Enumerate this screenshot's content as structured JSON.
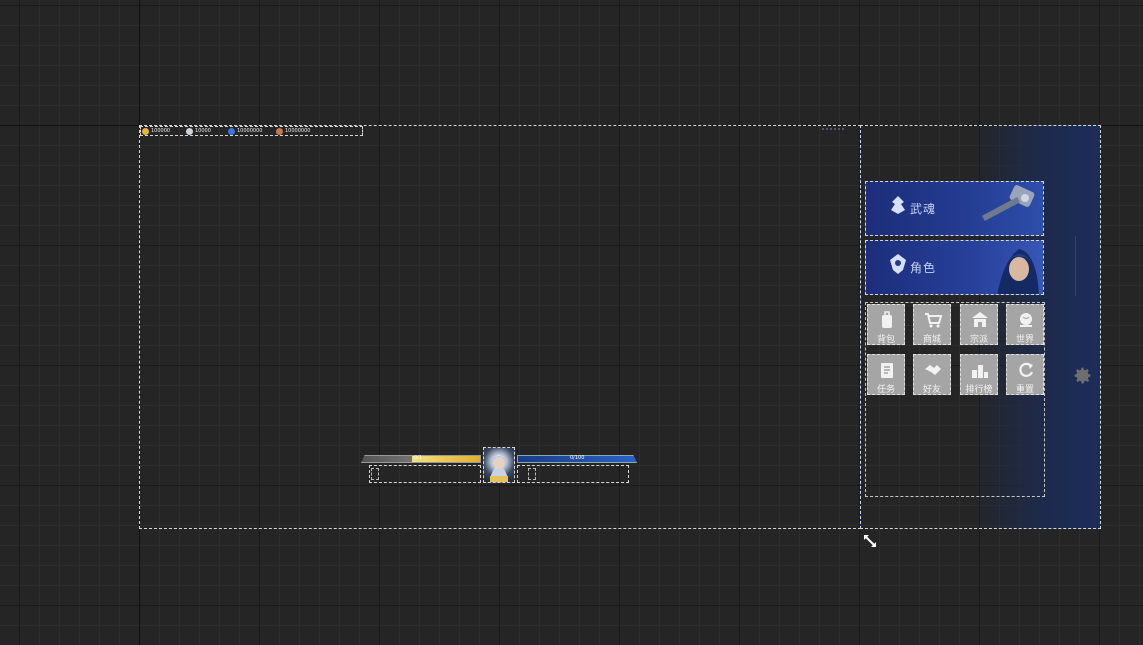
{
  "resources": [
    {
      "icon": "gold-coin-icon",
      "value": "100000",
      "color": "#e8b43a"
    },
    {
      "icon": "silver-coin-icon",
      "value": "10000",
      "color": "#cfd4d8"
    },
    {
      "icon": "blue-gem-icon",
      "value": "10000000",
      "color": "#3a74e0"
    },
    {
      "icon": "copper-coin-icon",
      "value": "10000000",
      "color": "#c57a4a"
    }
  ],
  "hud": {
    "hp_text": "0/1",
    "mp_text": "0/100",
    "hp_color": "#f0d060",
    "mp_color": "#2a62c6"
  },
  "side_menu": {
    "main_buttons": [
      {
        "label": "武魂",
        "icon": "soul-emblem-icon"
      },
      {
        "label": "角色",
        "icon": "role-emblem-icon"
      }
    ],
    "small_buttons": [
      {
        "label": "背包",
        "icon": "backpack-icon"
      },
      {
        "label": "商城",
        "icon": "shop-cart-icon"
      },
      {
        "label": "宗派",
        "icon": "sect-temple-icon"
      },
      {
        "label": "世界",
        "icon": "world-globe-icon"
      },
      {
        "label": "任务",
        "icon": "task-scroll-icon"
      },
      {
        "label": "好友",
        "icon": "friends-handshake-icon"
      },
      {
        "label": "排行榜",
        "icon": "leaderboard-icon"
      },
      {
        "label": "重置",
        "icon": "reset-refresh-icon"
      }
    ]
  },
  "accent_color": "#233a8f"
}
